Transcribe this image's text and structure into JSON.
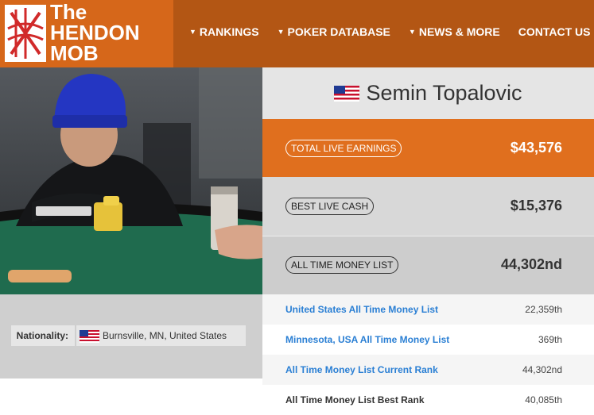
{
  "header": {
    "logo": {
      "line1": "The",
      "line2": "HENDON",
      "line3": "MOB"
    },
    "nav": [
      {
        "label": "RANKINGS",
        "dropdown": true
      },
      {
        "label": "POKER DATABASE",
        "dropdown": true
      },
      {
        "label": "NEWS & MORE",
        "dropdown": true
      },
      {
        "label": "CONTACT US",
        "dropdown": false
      }
    ],
    "caret": "▼"
  },
  "player": {
    "name": "Semin Topalovic",
    "flag": "us-flag-icon",
    "nationality_label": "Nationality:",
    "nationality_value": "Burnsville, MN, United States"
  },
  "stats": [
    {
      "label": "TOTAL LIVE EARNINGS",
      "value": "$43,576"
    },
    {
      "label": "BEST LIVE CASH",
      "value": "$15,376"
    },
    {
      "label": "ALL TIME MONEY LIST",
      "value": "44,302nd"
    }
  ],
  "rankings": [
    {
      "label": "United States All Time Money List",
      "value": "22,359th",
      "link": true
    },
    {
      "label": "Minnesota, USA All Time Money List",
      "value": "369th",
      "link": true
    },
    {
      "label": "All Time Money List Current Rank",
      "value": "44,302nd",
      "link": true
    },
    {
      "label": "All Time Money List Best Rank",
      "value": "40,085th",
      "link": false
    }
  ],
  "colors": {
    "header_bg": "#b35614",
    "accent_orange": "#e06f1e",
    "link_blue": "#2a7fd4"
  }
}
